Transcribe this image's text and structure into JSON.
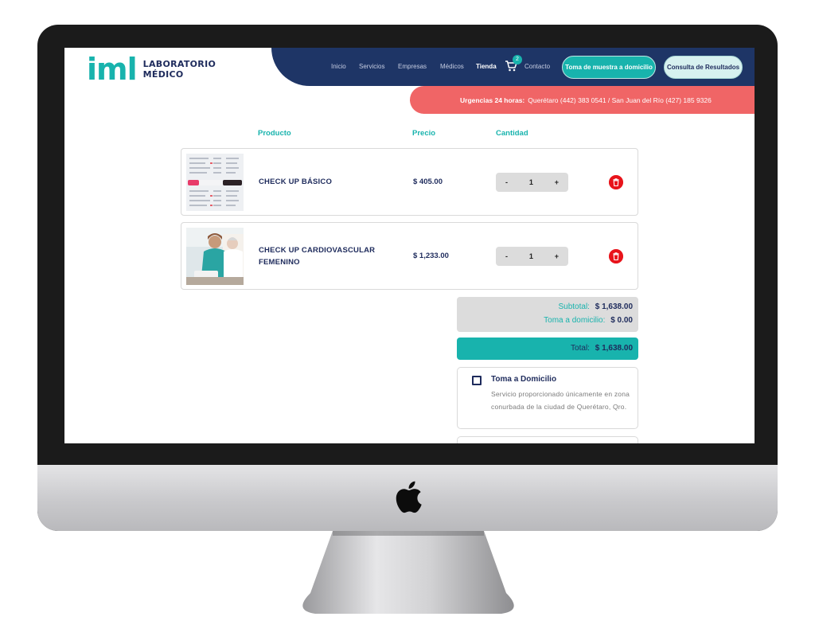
{
  "logo": {
    "mark": "iml",
    "line1": "LABORATORIO",
    "line2": "MÉDICO"
  },
  "nav": {
    "items": [
      {
        "label": "Inicio"
      },
      {
        "label": "Servicios"
      },
      {
        "label": "Empresas"
      },
      {
        "label": "Médicos"
      },
      {
        "label": "Tienda",
        "active": true
      },
      {
        "label": "Contacto"
      }
    ],
    "cart_count": "2",
    "cta_primary": "Toma de muestra a domicilio",
    "cta_secondary": "Consulta de Resultados"
  },
  "urgent": {
    "label": "Urgencias 24 horas:",
    "text": "Querétaro (442) 383 0541 / San Juan del Río (427) 185 9326"
  },
  "table": {
    "headers": {
      "product": "Producto",
      "price": "Precio",
      "quantity": "Cantidad"
    },
    "rows": [
      {
        "name": "CHECK UP BÁSICO",
        "price": "$ 405.00",
        "qty": "1",
        "minus": "-",
        "plus": "+",
        "thumb_icon": "blood-sample-tube-image"
      },
      {
        "name": "CHECK UP CARDIOVASCULAR FEMENINO",
        "price": "$ 1,233.00",
        "qty": "1",
        "minus": "-",
        "plus": "+",
        "thumb_icon": "nurse-with-patient-image"
      }
    ]
  },
  "summary": {
    "subtotal_label": "Subtotal:",
    "subtotal_value": "$ 1,638.00",
    "home_label": "Toma a domicilio:",
    "home_value": "$ 0.00",
    "total_label": "Total:",
    "total_value": "$ 1,638.00"
  },
  "option": {
    "title": "Toma a Domicilio",
    "description": "Servicio proporcionado únicamente en zona conurbada de la ciudad de Querétaro, Qro.",
    "checked": false
  },
  "colors": {
    "teal": "#18b3ad",
    "navy": "#1e3566",
    "coral": "#f06566",
    "trash_red": "#e8141b"
  }
}
